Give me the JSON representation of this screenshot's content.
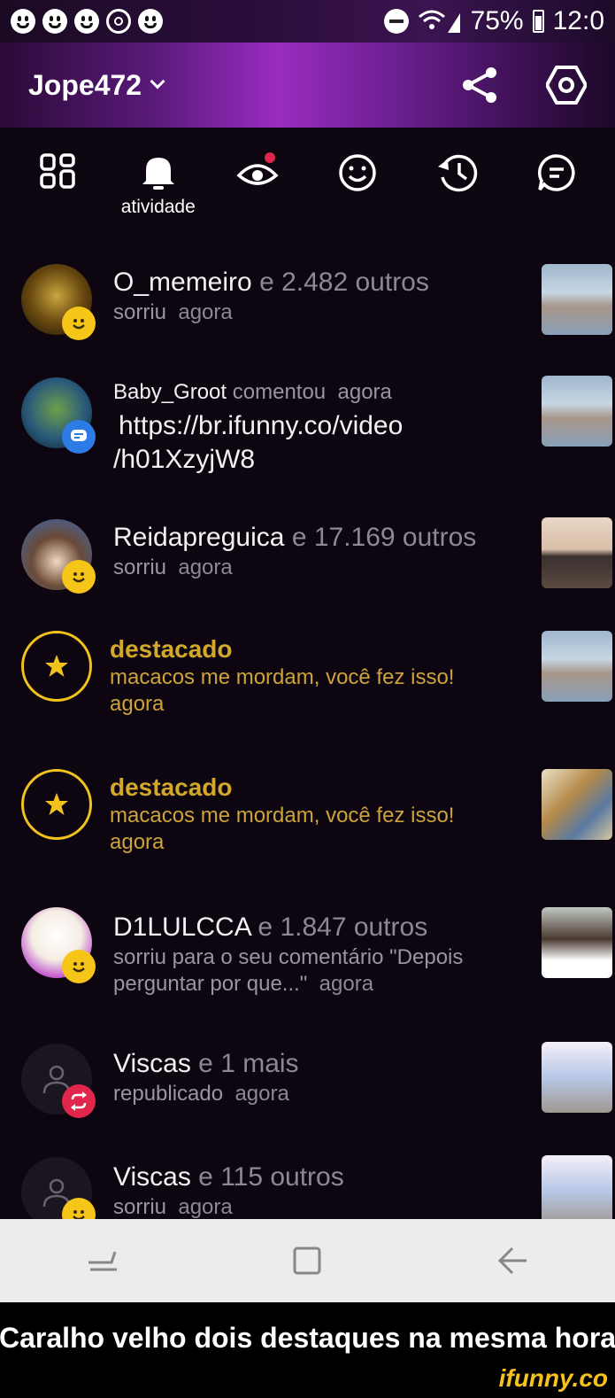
{
  "status_bar": {
    "icons_left": [
      "smiley-icon",
      "smiley-icon",
      "smiley-icon",
      "whatsapp-icon",
      "smiley-icon"
    ],
    "battery": "75%",
    "time": "12:0"
  },
  "header": {
    "username": "Jope472",
    "actions": [
      "share-icon",
      "settings-icon"
    ]
  },
  "tabs": [
    {
      "name": "grid-icon",
      "label": ""
    },
    {
      "name": "bell-icon",
      "label": "atividade",
      "active": true
    },
    {
      "name": "eye-icon",
      "label": "",
      "dot": true
    },
    {
      "name": "smiley-icon",
      "label": ""
    },
    {
      "name": "history-icon",
      "label": ""
    },
    {
      "name": "chat-icon",
      "label": ""
    }
  ],
  "feed": [
    {
      "user": "O_memeiro",
      "rest": "e 2.482 outros",
      "action": "sorriu",
      "time": "agora",
      "badge": "smile"
    },
    {
      "user": "Baby_Groot",
      "rest": "comentou",
      "time": "agora",
      "link_line1": "https://br.ifunny.co/video",
      "link_line2": "/h01XzyjW8",
      "badge": "comment"
    },
    {
      "user": "Reidapreguica",
      "rest": "e 17.169 outros",
      "action": "sorriu",
      "time": "agora",
      "badge": "smile"
    },
    {
      "title": "destacado",
      "text": "macacos me mordam, você fez isso!",
      "time": "agora"
    },
    {
      "title": "destacado",
      "text": "macacos me mordam, você fez isso!",
      "time": "agora"
    },
    {
      "user": "D1LULCCA",
      "rest": "e 1.847 outros",
      "action_line1": "sorriu para o seu comentário \"Depois",
      "action_line2": "perguntar por que...\"",
      "time": "agora",
      "badge": "smile"
    },
    {
      "user": "Viscas",
      "rest": "e 1 mais",
      "action": "republicado",
      "time": "agora",
      "badge": "repub"
    },
    {
      "user": "Viscas",
      "rest": "e 115 outros",
      "action": "sorriu",
      "time": "agora",
      "badge": "smile"
    }
  ],
  "navbar": [
    "recent-apps-icon",
    "home-icon",
    "back-icon"
  ],
  "caption": "Caralho velho dois destaques na mesma hora",
  "watermark": "ifunny.co",
  "colors": {
    "gold": "#d4a82a",
    "accent_purple": "#9a2cc0",
    "smile_badge": "#f5c518",
    "comment_badge": "#2d7be5",
    "repub_badge": "#e0264a"
  }
}
